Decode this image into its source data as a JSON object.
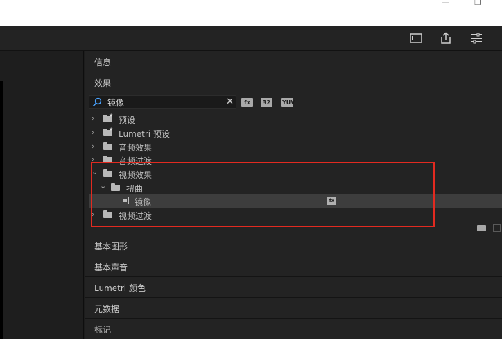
{
  "window": {
    "minimize_glyph": "—",
    "restore_glyph": "❐"
  },
  "toolbar": {
    "icons": [
      "panel-layout-icon",
      "export-icon",
      "workspace-menu-icon"
    ]
  },
  "panels": {
    "info": "信息",
    "effects": "效果",
    "essential_graphics": "基本图形",
    "essential_sound": "基本声音",
    "lumetri_color": "Lumetri 颜色",
    "metadata": "元数据",
    "markers": "标记"
  },
  "search": {
    "value": "镜像",
    "clear_glyph": "✕"
  },
  "filters": {
    "accelerated": "fx",
    "bit32": "32",
    "yuv": "YUV"
  },
  "tree": [
    {
      "label": "预设",
      "chevron": "›",
      "icon": "preset-folder-icon"
    },
    {
      "label": "Lumetri 预设",
      "chevron": "›",
      "icon": "preset-folder-icon"
    },
    {
      "label": "音频效果",
      "chevron": "›",
      "icon": "folder-icon"
    },
    {
      "label": "音频过渡",
      "chevron": "›",
      "icon": "folder-icon"
    },
    {
      "label": "视频效果",
      "chevron": "⌄",
      "icon": "folder-icon"
    },
    {
      "label": "扭曲",
      "chevron": "⌄",
      "icon": "folder-icon"
    },
    {
      "label": "镜像",
      "chevron": "",
      "icon": "effect-icon",
      "selected": true
    },
    {
      "label": "视频过渡",
      "chevron": "›",
      "icon": "folder-icon"
    }
  ],
  "colors": {
    "highlight_frame": "#e22a20",
    "panel_bg": "#232323",
    "selected_row": "#3d3d3d"
  }
}
